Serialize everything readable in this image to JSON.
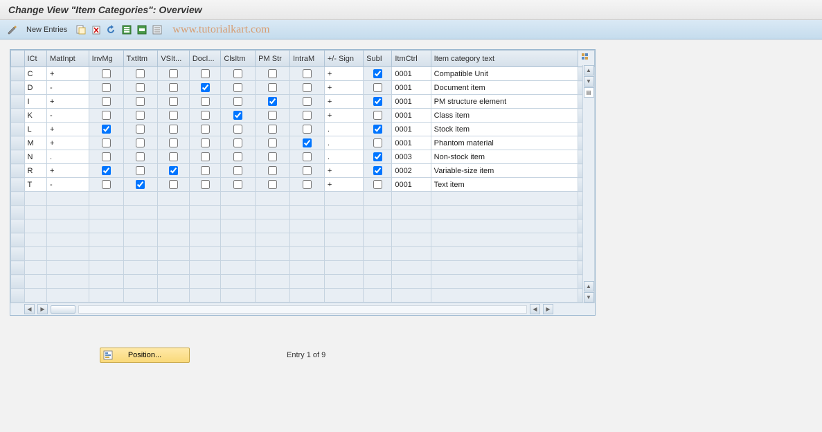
{
  "title": "Change View \"Item Categories\": Overview",
  "toolbar": {
    "new_entries_label": "New Entries",
    "icons": [
      "display-change",
      "copy-as",
      "delete",
      "undo-change",
      "select-all",
      "select-block",
      "deselect-all"
    ]
  },
  "watermark": "www.tutorialkart.com",
  "table": {
    "headers": [
      "ICt",
      "MatInpt",
      "InvMg",
      "TxtItm",
      "VSIt...",
      "DocI...",
      "ClsItm",
      "PM Str",
      "IntraM",
      "+/- Sign",
      "SubI",
      "ItmCtrl",
      "Item category text"
    ],
    "rows": [
      {
        "ict": "C",
        "matinpt": "+",
        "invmg": false,
        "txtitm": false,
        "vsit": false,
        "doci": false,
        "clsitm": false,
        "pmstr": false,
        "intram": false,
        "sign": "+",
        "subi": true,
        "itmctrl": "0001",
        "text": "Compatible Unit"
      },
      {
        "ict": "D",
        "matinpt": "-",
        "invmg": false,
        "txtitm": false,
        "vsit": false,
        "doci": true,
        "clsitm": false,
        "pmstr": false,
        "intram": false,
        "sign": "+",
        "subi": false,
        "itmctrl": "0001",
        "text": "Document item"
      },
      {
        "ict": "I",
        "matinpt": "+",
        "invmg": false,
        "txtitm": false,
        "vsit": false,
        "doci": false,
        "clsitm": false,
        "pmstr": true,
        "intram": false,
        "sign": "+",
        "subi": true,
        "itmctrl": "0001",
        "text": "PM structure element"
      },
      {
        "ict": "K",
        "matinpt": "-",
        "invmg": false,
        "txtitm": false,
        "vsit": false,
        "doci": false,
        "clsitm": true,
        "pmstr": false,
        "intram": false,
        "sign": "+",
        "subi": false,
        "itmctrl": "0001",
        "text": "Class item"
      },
      {
        "ict": "L",
        "matinpt": "+",
        "invmg": true,
        "txtitm": false,
        "vsit": false,
        "doci": false,
        "clsitm": false,
        "pmstr": false,
        "intram": false,
        "sign": ".",
        "subi": true,
        "itmctrl": "0001",
        "text": "Stock item"
      },
      {
        "ict": "M",
        "matinpt": "+",
        "invmg": false,
        "txtitm": false,
        "vsit": false,
        "doci": false,
        "clsitm": false,
        "pmstr": false,
        "intram": true,
        "sign": ".",
        "subi": false,
        "itmctrl": "0001",
        "text": "Phantom material"
      },
      {
        "ict": "N",
        "matinpt": ".",
        "invmg": false,
        "txtitm": false,
        "vsit": false,
        "doci": false,
        "clsitm": false,
        "pmstr": false,
        "intram": false,
        "sign": ".",
        "subi": true,
        "itmctrl": "0003",
        "text": "Non-stock item"
      },
      {
        "ict": "R",
        "matinpt": "+",
        "invmg": true,
        "txtitm": false,
        "vsit": true,
        "doci": false,
        "clsitm": false,
        "pmstr": false,
        "intram": false,
        "sign": "+",
        "subi": true,
        "itmctrl": "0002",
        "text": "Variable-size item"
      },
      {
        "ict": "T",
        "matinpt": "-",
        "invmg": false,
        "txtitm": true,
        "vsit": false,
        "doci": false,
        "clsitm": false,
        "pmstr": false,
        "intram": false,
        "sign": "+",
        "subi": false,
        "itmctrl": "0001",
        "text": "Text item"
      }
    ],
    "empty_rows": 8
  },
  "position": {
    "button_label": "Position...",
    "status": "Entry 1 of 9"
  }
}
